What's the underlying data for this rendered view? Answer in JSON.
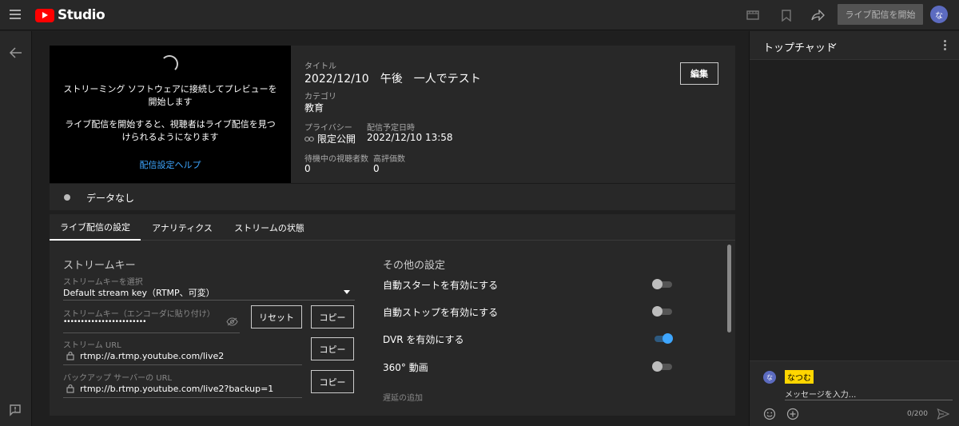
{
  "header": {
    "logo_text": "Studio",
    "start_button": "ライブ配信を開始",
    "avatar_initial": "な"
  },
  "preview": {
    "message1": "ストリーミング ソフトウェアに接続してプレビューを開始します",
    "message2": "ライブ配信を開始すると、視聴者はライブ配信を見つけられるようになります",
    "help_link": "配信設定ヘルプ"
  },
  "info": {
    "title_label": "タイトル",
    "title_value": "2022/12/10　午後　一人でテスト",
    "category_label": "カテゴリ",
    "category_value": "教育",
    "privacy_label": "プライバシー",
    "privacy_value": "限定公開",
    "scheduled_label": "配信予定日時",
    "scheduled_value": "2022/12/10 13:58",
    "waiting_label": "待機中の視聴者数",
    "waiting_value": "0",
    "likes_label": "高評価数",
    "likes_value": "0",
    "edit_button": "編集"
  },
  "status": {
    "data_text": "データなし"
  },
  "tabs": [
    {
      "label": "ライブ配信の設定",
      "active": true
    },
    {
      "label": "アナリティクス",
      "active": false
    },
    {
      "label": "ストリームの状態",
      "active": false
    }
  ],
  "stream_key": {
    "section_title": "ストリームキー",
    "select_label": "ストリームキーを選択",
    "select_value": "Default stream key（RTMP、可変）",
    "key_label": "ストリームキー（エンコーダに貼り付け）",
    "key_value": "••••••••••••••••••••••••",
    "reset_button": "リセット",
    "copy_button": "コピー",
    "url_label": "ストリーム URL",
    "url_value": "rtmp://a.rtmp.youtube.com/live2",
    "backup_label": "バックアップ サーバーの URL",
    "backup_value": "rtmp://b.rtmp.youtube.com/live2?backup=1"
  },
  "other_settings": {
    "section_title": "その他の設定",
    "options": [
      {
        "label": "自動スタートを有効にする",
        "on": false
      },
      {
        "label": "自動ストップを有効にする",
        "on": false
      },
      {
        "label": "DVR を有効にする",
        "on": true
      },
      {
        "label": "360° 動画",
        "on": false
      }
    ],
    "delay_label": "遅延の追加"
  },
  "chat": {
    "title": "トップチャット",
    "avatar_initial": "な",
    "user_name": "なつむ",
    "placeholder": "メッセージを入力...",
    "counter": "0/200"
  },
  "colors": {
    "accent_blue": "#3ea6ff",
    "youtube_red": "#ff0000",
    "name_highlight": "#ffd600"
  }
}
